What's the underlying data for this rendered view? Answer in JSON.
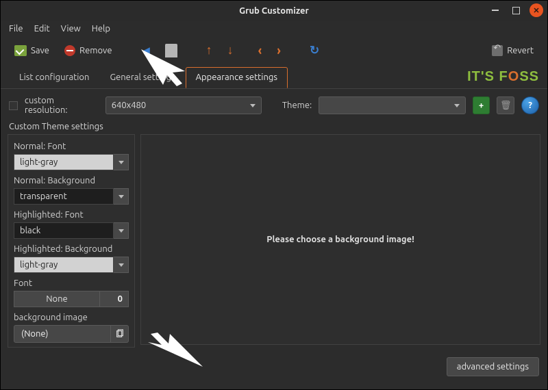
{
  "window": {
    "title": "Grub Customizer"
  },
  "menu": {
    "file": "File",
    "edit": "Edit",
    "view": "View",
    "help": "Help"
  },
  "toolbar": {
    "save_label": "Save",
    "remove_label": "Remove",
    "revert_label": "Revert"
  },
  "tabs": {
    "list": "List configuration",
    "general": "General settings",
    "appearance": "Appearance settings"
  },
  "brand": {
    "its": "IT'S ",
    "f": "F",
    "o": "O",
    "ss": "SS"
  },
  "resolution": {
    "checkbox_label": "custom resolution:",
    "value": "640x480"
  },
  "theme": {
    "label": "Theme:",
    "value": ""
  },
  "section": {
    "custom_theme": "Custom Theme settings"
  },
  "fields": {
    "normal_font": {
      "label": "Normal: Font",
      "value": "light-gray"
    },
    "normal_bg": {
      "label": "Normal: Background",
      "value": "transparent"
    },
    "hl_font": {
      "label": "Highlighted: Font",
      "value": "black"
    },
    "hl_bg": {
      "label": "Highlighted: Background",
      "value": "light-gray"
    },
    "font": {
      "label": "Font",
      "none": "None",
      "size": "0"
    },
    "bg_image": {
      "label": "background image",
      "value": "(None)"
    }
  },
  "preview": {
    "placeholder": "Please choose a background image!"
  },
  "footer": {
    "advanced": "advanced settings"
  }
}
